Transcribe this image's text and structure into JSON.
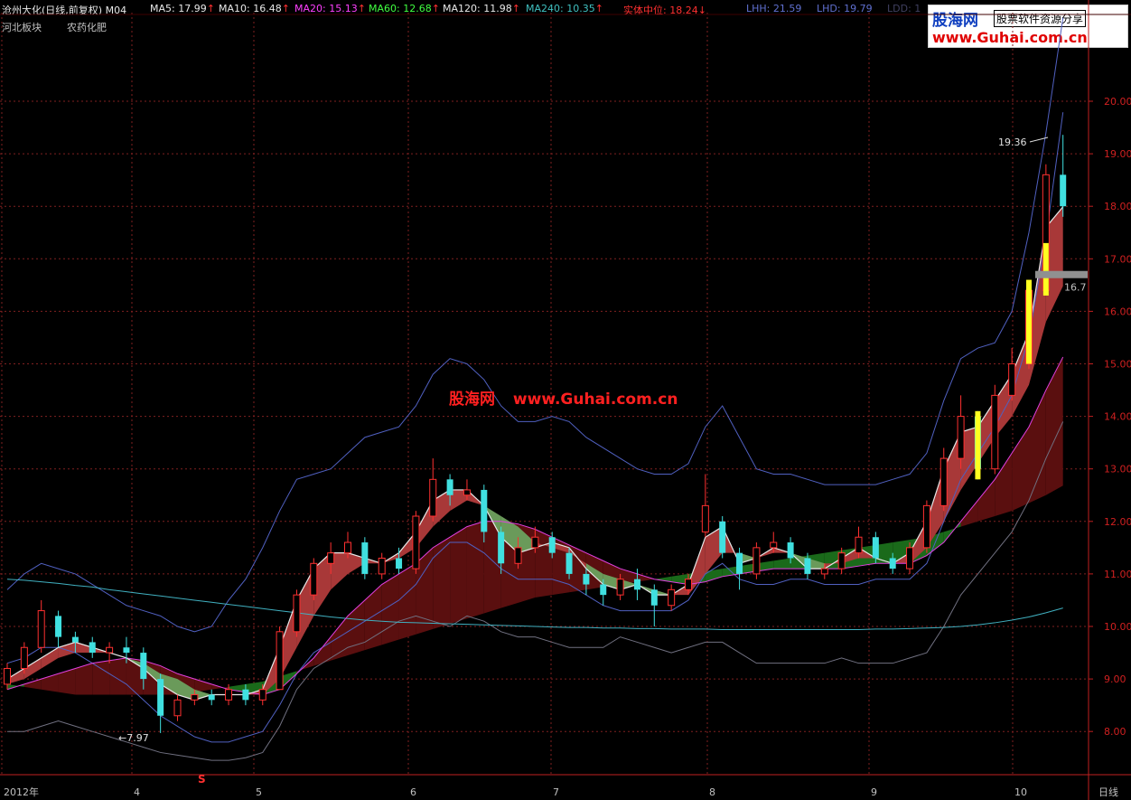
{
  "header": {
    "title": "沧州大化(日线,前复权) M04",
    "indicators": [
      {
        "label": "MA5: 17.99",
        "arrow": "↑",
        "color": "#e8e8e8",
        "x": 166
      },
      {
        "label": "MA10: 16.48",
        "arrow": "↑",
        "color": "#e8e8e8",
        "x": 242
      },
      {
        "label": "MA20: 15.13",
        "arrow": "↑",
        "color": "#ff40ff",
        "x": 326
      },
      {
        "label": "MA60: 12.68",
        "arrow": "↑",
        "color": "#40ff40",
        "x": 408
      },
      {
        "label": "MA120: 11.98",
        "arrow": "↑",
        "color": "#e8e8e8",
        "x": 490
      },
      {
        "label": "MA240: 10.35",
        "arrow": "↑",
        "color": "#40c0c0",
        "x": 582
      },
      {
        "label": "实体中位: 18.24",
        "arrow": "↓",
        "color": "#ff3030",
        "x": 690
      },
      {
        "label": "LHH: 21.59",
        "arrow": "",
        "color": "#6070d0",
        "x": 826
      },
      {
        "label": "LHD: 19.79",
        "arrow": "",
        "color": "#6070d0",
        "x": 904
      },
      {
        "label": "LDD: 1",
        "arrow": "",
        "color": "#404060",
        "x": 982
      }
    ],
    "sector": "河北板块",
    "industry": "农药化肥"
  },
  "logo": {
    "name": "股海网",
    "slogan": "股票软件资源分享",
    "url": "www.Guhai.com.cn"
  },
  "watermark": {
    "name": "股海网",
    "url": "www.Guhai.com.cn"
  },
  "period_label": "日线",
  "chart_data": {
    "type": "candlestick",
    "yticks": [
      "20.00",
      "19.00",
      "18.00",
      "17.00",
      "16.00",
      "15.00",
      "14.00",
      "13.00",
      "12.00",
      "11.00",
      "10.00",
      "9.00",
      "8.00"
    ],
    "ylim": [
      7.5,
      21.6
    ],
    "xticks": [
      "2012年",
      "4",
      "5",
      "6",
      "7",
      "8",
      "9",
      "10"
    ],
    "grid": true,
    "annotations": {
      "high_label": "19.36",
      "low_label": "7.97",
      "signal_label": "S",
      "level_label": "16.7"
    },
    "series": [
      {
        "name": "MA5",
        "values": [
          9.0,
          9.2,
          9.4,
          9.6,
          9.7,
          9.6,
          9.5,
          9.4,
          9.2,
          8.9,
          8.7,
          8.6,
          8.7,
          8.7,
          8.7,
          8.8,
          9.6,
          10.5,
          11.1,
          11.4,
          11.4,
          11.3,
          11.2,
          11.4,
          11.8,
          12.4,
          12.6,
          12.6,
          12.3,
          11.7,
          11.4,
          11.5,
          11.6,
          11.5,
          11.1,
          10.8,
          10.7,
          10.8,
          10.6,
          10.6,
          10.8,
          11.7,
          11.9,
          11.2,
          11.3,
          11.5,
          11.4,
          11.1,
          11.1,
          11.3,
          11.5,
          11.3,
          11.2,
          11.4,
          12.0,
          13.0,
          13.7,
          13.8,
          14.3,
          14.8,
          15.6,
          17.6,
          17.99
        ]
      },
      {
        "name": "MA10",
        "values": [
          8.9,
          9.0,
          9.2,
          9.4,
          9.5,
          9.5,
          9.5,
          9.4,
          9.3,
          9.1,
          9.0,
          8.8,
          8.7,
          8.7,
          8.7,
          8.7,
          9.0,
          9.6,
          10.2,
          10.7,
          11.0,
          11.2,
          11.2,
          11.3,
          11.5,
          11.9,
          12.2,
          12.4,
          12.3,
          12.1,
          11.9,
          11.6,
          11.5,
          11.4,
          11.2,
          11.0,
          10.9,
          10.8,
          10.7,
          10.6,
          10.6,
          11.0,
          11.4,
          11.4,
          11.3,
          11.4,
          11.4,
          11.3,
          11.2,
          11.2,
          11.3,
          11.3,
          11.2,
          11.2,
          11.5,
          12.0,
          12.6,
          13.1,
          13.6,
          14.0,
          14.6,
          15.8,
          16.48
        ]
      },
      {
        "name": "MA20",
        "values": [
          8.8,
          8.9,
          9.0,
          9.1,
          9.2,
          9.3,
          9.35,
          9.4,
          9.35,
          9.25,
          9.1,
          9.0,
          8.9,
          8.8,
          8.75,
          8.7,
          8.8,
          9.1,
          9.4,
          9.8,
          10.2,
          10.5,
          10.8,
          11.0,
          11.2,
          11.5,
          11.7,
          11.9,
          12.0,
          12.0,
          11.95,
          11.85,
          11.7,
          11.55,
          11.4,
          11.25,
          11.1,
          11.0,
          10.9,
          10.85,
          10.8,
          10.85,
          10.95,
          11.0,
          11.05,
          11.1,
          11.1,
          11.1,
          11.1,
          11.1,
          11.15,
          11.2,
          11.2,
          11.2,
          11.35,
          11.6,
          12.0,
          12.4,
          12.8,
          13.3,
          13.8,
          14.5,
          15.13
        ]
      },
      {
        "name": "MA60",
        "values": [
          8.9,
          8.85,
          8.8,
          8.75,
          8.7,
          8.7,
          8.7,
          8.7,
          8.7,
          8.7,
          8.7,
          8.75,
          8.8,
          8.85,
          8.9,
          8.95,
          9.05,
          9.15,
          9.25,
          9.35,
          9.45,
          9.55,
          9.65,
          9.75,
          9.85,
          9.95,
          10.05,
          10.15,
          10.25,
          10.35,
          10.45,
          10.55,
          10.6,
          10.65,
          10.7,
          10.75,
          10.8,
          10.85,
          10.9,
          10.95,
          11.0,
          11.05,
          11.1,
          11.15,
          11.2,
          11.25,
          11.3,
          11.35,
          11.4,
          11.45,
          11.5,
          11.55,
          11.6,
          11.65,
          11.7,
          11.8,
          11.9,
          12.0,
          12.1,
          12.2,
          12.35,
          12.5,
          12.68
        ]
      },
      {
        "name": "MA240",
        "values": [
          10.9,
          10.88,
          10.85,
          10.82,
          10.78,
          10.75,
          10.7,
          10.66,
          10.62,
          10.58,
          10.54,
          10.5,
          10.46,
          10.42,
          10.38,
          10.34,
          10.3,
          10.26,
          10.22,
          10.18,
          10.15,
          10.12,
          10.1,
          10.08,
          10.07,
          10.06,
          10.05,
          10.04,
          10.03,
          10.02,
          10.01,
          10.0,
          9.99,
          9.98,
          9.98,
          9.97,
          9.97,
          9.96,
          9.96,
          9.95,
          9.95,
          9.95,
          9.94,
          9.94,
          9.94,
          9.94,
          9.94,
          9.94,
          9.94,
          9.94,
          9.94,
          9.95,
          9.95,
          9.96,
          9.97,
          9.98,
          10.0,
          10.03,
          10.07,
          10.12,
          10.18,
          10.26,
          10.35
        ]
      },
      {
        "name": "LHH",
        "values": [
          10.7,
          11.0,
          11.2,
          11.1,
          11.0,
          10.8,
          10.6,
          10.4,
          10.3,
          10.2,
          10.0,
          9.9,
          10.0,
          10.5,
          10.9,
          11.5,
          12.2,
          12.8,
          12.9,
          13.0,
          13.3,
          13.6,
          13.7,
          13.8,
          14.2,
          14.8,
          15.1,
          15.0,
          14.7,
          14.2,
          13.9,
          13.9,
          14.0,
          13.9,
          13.6,
          13.4,
          13.2,
          13.0,
          12.9,
          12.9,
          13.1,
          13.8,
          14.2,
          13.6,
          13.0,
          12.9,
          12.9,
          12.8,
          12.7,
          12.7,
          12.7,
          12.7,
          12.8,
          12.9,
          13.3,
          14.3,
          15.1,
          15.3,
          15.4,
          16.0,
          17.5,
          19.4,
          21.59
        ]
      },
      {
        "name": "LHD",
        "values": [
          9.3,
          9.4,
          9.6,
          9.6,
          9.5,
          9.3,
          9.1,
          8.9,
          8.6,
          8.3,
          8.1,
          7.9,
          7.8,
          7.8,
          7.9,
          8.0,
          8.5,
          9.1,
          9.5,
          9.7,
          9.9,
          10.1,
          10.3,
          10.5,
          10.8,
          11.3,
          11.6,
          11.6,
          11.4,
          11.1,
          10.9,
          10.9,
          10.9,
          10.8,
          10.6,
          10.4,
          10.3,
          10.3,
          10.3,
          10.3,
          10.5,
          11.0,
          11.2,
          10.9,
          10.8,
          10.8,
          10.9,
          10.9,
          10.8,
          10.8,
          10.8,
          10.9,
          10.9,
          10.9,
          11.2,
          12.0,
          12.8,
          13.3,
          13.8,
          14.4,
          15.5,
          17.4,
          19.79
        ]
      },
      {
        "name": "LDD",
        "values": [
          8.0,
          8.0,
          8.1,
          8.2,
          8.1,
          8.0,
          7.9,
          7.8,
          7.7,
          7.6,
          7.55,
          7.5,
          7.45,
          7.45,
          7.5,
          7.6,
          8.1,
          8.8,
          9.2,
          9.4,
          9.6,
          9.7,
          9.9,
          10.1,
          10.2,
          10.1,
          10.0,
          10.2,
          10.1,
          9.9,
          9.8,
          9.8,
          9.7,
          9.6,
          9.6,
          9.6,
          9.8,
          9.7,
          9.6,
          9.5,
          9.6,
          9.7,
          9.7,
          9.5,
          9.3,
          9.3,
          9.3,
          9.3,
          9.3,
          9.4,
          9.3,
          9.3,
          9.3,
          9.4,
          9.5,
          10.0,
          10.6,
          11.0,
          11.4,
          11.8,
          12.4,
          13.2,
          13.9
        ]
      }
    ],
    "candles": [
      [
        8.9,
        9.2,
        9.3,
        8.8
      ],
      [
        9.2,
        9.6,
        9.7,
        9.1
      ],
      [
        9.6,
        10.3,
        10.5,
        9.5
      ],
      [
        10.2,
        9.8,
        10.3,
        9.6
      ],
      [
        9.8,
        9.7,
        9.9,
        9.5
      ],
      [
        9.7,
        9.5,
        9.8,
        9.4
      ],
      [
        9.5,
        9.6,
        9.7,
        9.3
      ],
      [
        9.6,
        9.5,
        9.8,
        9.3
      ],
      [
        9.5,
        9.0,
        9.6,
        8.8
      ],
      [
        9.0,
        8.3,
        9.1,
        7.97
      ],
      [
        8.3,
        8.6,
        8.7,
        8.2
      ],
      [
        8.6,
        8.7,
        8.8,
        8.5
      ],
      [
        8.7,
        8.6,
        8.8,
        8.5
      ],
      [
        8.6,
        8.8,
        8.9,
        8.5
      ],
      [
        8.8,
        8.6,
        8.9,
        8.5
      ],
      [
        8.6,
        8.8,
        8.9,
        8.5
      ],
      [
        8.8,
        9.9,
        10.0,
        8.8
      ],
      [
        9.9,
        10.6,
        10.7,
        9.8
      ],
      [
        10.6,
        11.2,
        11.3,
        10.5
      ],
      [
        11.2,
        11.4,
        11.6,
        11.0
      ],
      [
        11.4,
        11.6,
        11.8,
        11.3
      ],
      [
        11.6,
        11.0,
        11.7,
        10.9
      ],
      [
        11.0,
        11.3,
        11.4,
        10.9
      ],
      [
        11.3,
        11.1,
        11.5,
        11.0
      ],
      [
        11.1,
        12.1,
        12.2,
        11.0
      ],
      [
        12.1,
        12.8,
        13.2,
        12.0
      ],
      [
        12.8,
        12.5,
        12.9,
        12.3
      ],
      [
        12.5,
        12.6,
        12.8,
        12.4
      ],
      [
        12.6,
        11.8,
        12.7,
        11.6
      ],
      [
        11.8,
        11.2,
        11.9,
        11.0
      ],
      [
        11.2,
        11.5,
        11.7,
        11.1
      ],
      [
        11.5,
        11.7,
        11.9,
        11.4
      ],
      [
        11.7,
        11.4,
        11.8,
        11.3
      ],
      [
        11.4,
        11.0,
        11.5,
        10.9
      ],
      [
        11.0,
        10.8,
        11.1,
        10.6
      ],
      [
        10.8,
        10.6,
        10.9,
        10.4
      ],
      [
        10.6,
        10.9,
        11.0,
        10.5
      ],
      [
        10.9,
        10.7,
        11.1,
        10.5
      ],
      [
        10.7,
        10.4,
        10.8,
        10.0
      ],
      [
        10.4,
        10.7,
        10.8,
        10.3
      ],
      [
        10.7,
        10.9,
        11.0,
        10.6
      ],
      [
        11.8,
        12.3,
        12.9,
        11.7
      ],
      [
        12.0,
        11.4,
        12.1,
        11.3
      ],
      [
        11.4,
        11.0,
        11.5,
        10.7
      ],
      [
        11.0,
        11.5,
        11.6,
        10.9
      ],
      [
        11.5,
        11.6,
        11.8,
        11.4
      ],
      [
        11.6,
        11.3,
        11.7,
        11.2
      ],
      [
        11.3,
        11.0,
        11.4,
        10.9
      ],
      [
        11.0,
        11.1,
        11.2,
        10.9
      ],
      [
        11.1,
        11.4,
        11.5,
        11.0
      ],
      [
        11.4,
        11.7,
        11.9,
        11.3
      ],
      [
        11.7,
        11.3,
        11.8,
        11.2
      ],
      [
        11.3,
        11.1,
        11.4,
        11.0
      ],
      [
        11.1,
        11.5,
        11.6,
        11.0
      ],
      [
        11.5,
        12.3,
        12.4,
        11.4
      ],
      [
        12.3,
        13.2,
        13.4,
        12.2
      ],
      [
        13.2,
        14.0,
        14.4,
        13.0
      ],
      [
        14.0,
        13.0,
        14.1,
        12.8
      ],
      [
        13.0,
        14.4,
        14.6,
        12.9
      ],
      [
        14.4,
        15.0,
        15.3,
        14.3
      ],
      [
        15.0,
        16.4,
        16.6,
        14.9
      ],
      [
        16.4,
        18.6,
        18.8,
        16.3
      ],
      [
        18.6,
        18.0,
        19.36,
        17.8
      ]
    ]
  }
}
